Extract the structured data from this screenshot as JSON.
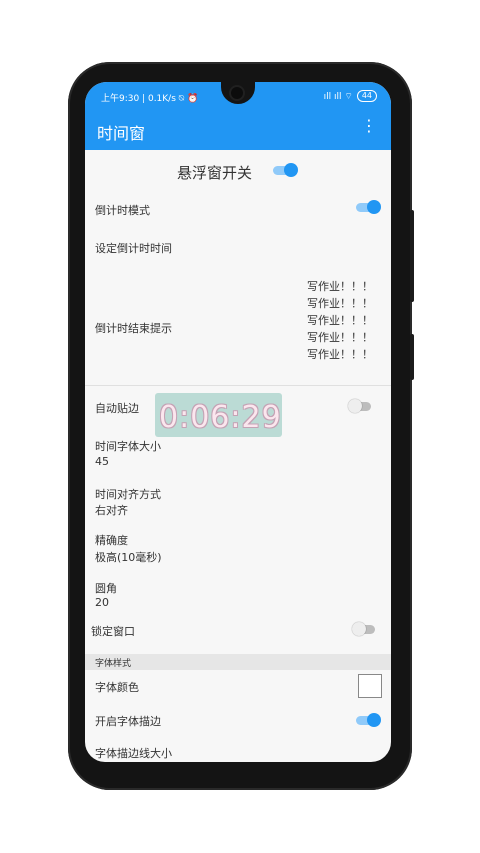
{
  "status_bar": {
    "left": "上午9:30 | 0.1K/s ⍉ ⏰",
    "signal": "ıll ıll ⌔",
    "battery": "44"
  },
  "app_bar": {
    "title": "时间窗",
    "menu_icon": "more-vert-icon"
  },
  "floating_switch": {
    "label": "悬浮窗开关",
    "on": true
  },
  "settings": {
    "countdown_mode": {
      "label": "倒计时模式",
      "on": true
    },
    "set_countdown_time": {
      "label": "设定倒计时时间"
    },
    "countdown_end_reminder": {
      "label": "倒计时结束提示",
      "lines": [
        "写作业！！！",
        "写作业！！！",
        "写作业！！！",
        "写作业！！！",
        "写作业！！！"
      ]
    },
    "auto_snap": {
      "label": "自动贴边",
      "on": false
    },
    "font_size": {
      "label": "时间字体大小",
      "value": "45"
    },
    "alignment": {
      "label": "时间对齐方式",
      "value": "右对齐"
    },
    "precision": {
      "label": "精确度",
      "value": "极高(10毫秒)"
    },
    "corner": {
      "label": "圆角",
      "value": "20"
    },
    "lock_window": {
      "label": "锁定窗口",
      "on": false
    },
    "font_style_section": {
      "label": "字体样式"
    },
    "font_color": {
      "label": "字体颜色",
      "color": "#ffffff"
    },
    "font_stroke": {
      "label": "开启字体描边",
      "on": true
    },
    "stroke_size": {
      "label": "字体描边线大小"
    }
  },
  "floating_clock": {
    "time": "0:06:29"
  },
  "colors": {
    "accent": "#2196f3",
    "accent_light": "#90caf9"
  }
}
